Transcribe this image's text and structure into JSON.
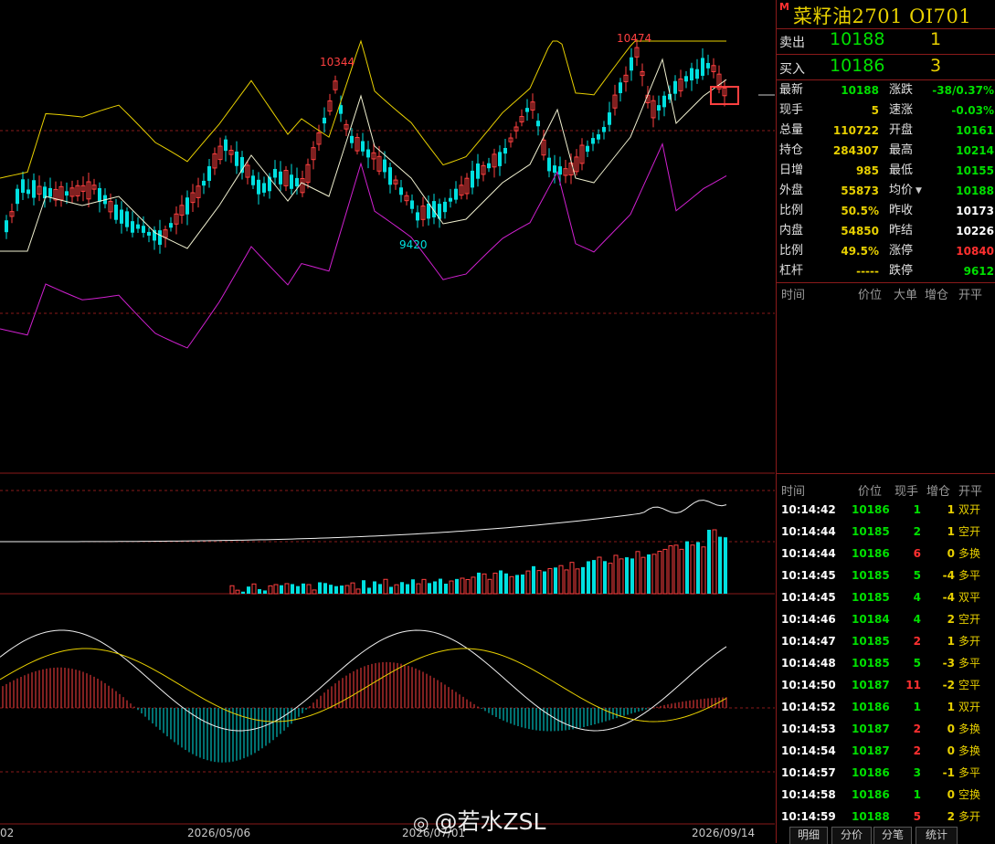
{
  "instrument": {
    "badge": "M",
    "title": "菜籽油2701  OI701"
  },
  "order_book": {
    "sell": {
      "label": "卖出",
      "price": "10188",
      "volume": "1"
    },
    "buy": {
      "label": "买入",
      "price": "10186",
      "volume": "3"
    }
  },
  "quote_left": [
    {
      "label": "最新",
      "value": "10188",
      "color": "#00e000"
    },
    {
      "label": "现手",
      "value": "5",
      "color": "#e8d000"
    },
    {
      "label": "总量",
      "value": "110722",
      "color": "#e8d000"
    },
    {
      "label": "持仓",
      "value": "284307",
      "color": "#e8d000"
    },
    {
      "label": "日增",
      "value": "985",
      "color": "#e8d000"
    },
    {
      "label": "外盘",
      "value": "55873",
      "color": "#e8d000"
    },
    {
      "label": "比例",
      "value": "50.5%",
      "color": "#e8d000"
    },
    {
      "label": "内盘",
      "value": "54850",
      "color": "#e8d000"
    },
    {
      "label": "比例",
      "value": "49.5%",
      "color": "#e8d000"
    },
    {
      "label": "杠杆",
      "value": "-----",
      "color": "#e8d000"
    }
  ],
  "quote_right": [
    {
      "label": "涨跌",
      "value": "-38/0.37%",
      "color": "#00e000"
    },
    {
      "label": "速涨",
      "value": "-0.03%",
      "color": "#00e000"
    },
    {
      "label": "开盘",
      "value": "10161",
      "color": "#00e000"
    },
    {
      "label": "最高",
      "value": "10214",
      "color": "#00e000"
    },
    {
      "label": "最低",
      "value": "10155",
      "color": "#00e000"
    },
    {
      "label": "均价",
      "value": "10188",
      "color": "#00e000"
    },
    {
      "label": "昨收",
      "value": "10173",
      "color": "#ffffff"
    },
    {
      "label": "昨结",
      "value": "10226",
      "color": "#ffffff"
    },
    {
      "label": "涨停",
      "value": "10840",
      "color": "#ff3030"
    },
    {
      "label": "跌停",
      "value": "9612",
      "color": "#00e000"
    }
  ],
  "big_order_header": {
    "time": "时间",
    "price": "价位",
    "big": "大单",
    "oi": "增仓",
    "kp": "开平"
  },
  "tick_header": {
    "time": "时间",
    "price": "价位",
    "qty": "现手",
    "oi": "增仓",
    "kp": "开平"
  },
  "ticks": [
    {
      "time": "10:14:42",
      "price": "10186",
      "qty": "1",
      "oi": "1",
      "kp": "双开",
      "qc": "#00e000"
    },
    {
      "time": "10:14:44",
      "price": "10185",
      "qty": "2",
      "oi": "1",
      "kp": "空开",
      "qc": "#00e000"
    },
    {
      "time": "10:14:44",
      "price": "10186",
      "qty": "6",
      "oi": "0",
      "kp": "多换",
      "qc": "#ff3030"
    },
    {
      "time": "10:14:45",
      "price": "10185",
      "qty": "5",
      "oi": "-4",
      "kp": "多平",
      "qc": "#00e000"
    },
    {
      "time": "10:14:45",
      "price": "10185",
      "qty": "4",
      "oi": "-4",
      "kp": "双平",
      "qc": "#00e000"
    },
    {
      "time": "10:14:46",
      "price": "10184",
      "qty": "4",
      "oi": "2",
      "kp": "空开",
      "qc": "#00e000"
    },
    {
      "time": "10:14:47",
      "price": "10185",
      "qty": "2",
      "oi": "1",
      "kp": "多开",
      "qc": "#ff3030"
    },
    {
      "time": "10:14:48",
      "price": "10185",
      "qty": "5",
      "oi": "-3",
      "kp": "多平",
      "qc": "#00e000"
    },
    {
      "time": "10:14:50",
      "price": "10187",
      "qty": "11",
      "oi": "-2",
      "kp": "空平",
      "qc": "#ff3030"
    },
    {
      "time": "10:14:52",
      "price": "10186",
      "qty": "1",
      "oi": "1",
      "kp": "双开",
      "qc": "#00e000"
    },
    {
      "time": "10:14:53",
      "price": "10187",
      "qty": "2",
      "oi": "0",
      "kp": "多换",
      "qc": "#ff3030"
    },
    {
      "time": "10:14:54",
      "price": "10187",
      "qty": "2",
      "oi": "0",
      "kp": "多换",
      "qc": "#ff3030"
    },
    {
      "time": "10:14:57",
      "price": "10186",
      "qty": "3",
      "oi": "-1",
      "kp": "多平",
      "qc": "#00e000"
    },
    {
      "time": "10:14:58",
      "price": "10186",
      "qty": "1",
      "oi": "0",
      "kp": "空换",
      "qc": "#00e000"
    },
    {
      "time": "10:14:59",
      "price": "10188",
      "qty": "5",
      "oi": "2",
      "kp": "多开",
      "qc": "#ff3030"
    }
  ],
  "tabs": [
    "明细",
    "分价",
    "分笔",
    "统计"
  ],
  "chart": {
    "high_label": "10474",
    "mid_label": "10344",
    "low_label": "9420",
    "date_labels": [
      "02",
      "2026/05/06",
      "2026/07/01",
      "2026/09/14"
    ]
  },
  "watermark": "@若水ZSL",
  "colors": {
    "up": "#ff4040",
    "down": "#00e0e0",
    "yellow": "#e8d000",
    "purple": "#d020d0",
    "grid": "#8a1a1a"
  }
}
